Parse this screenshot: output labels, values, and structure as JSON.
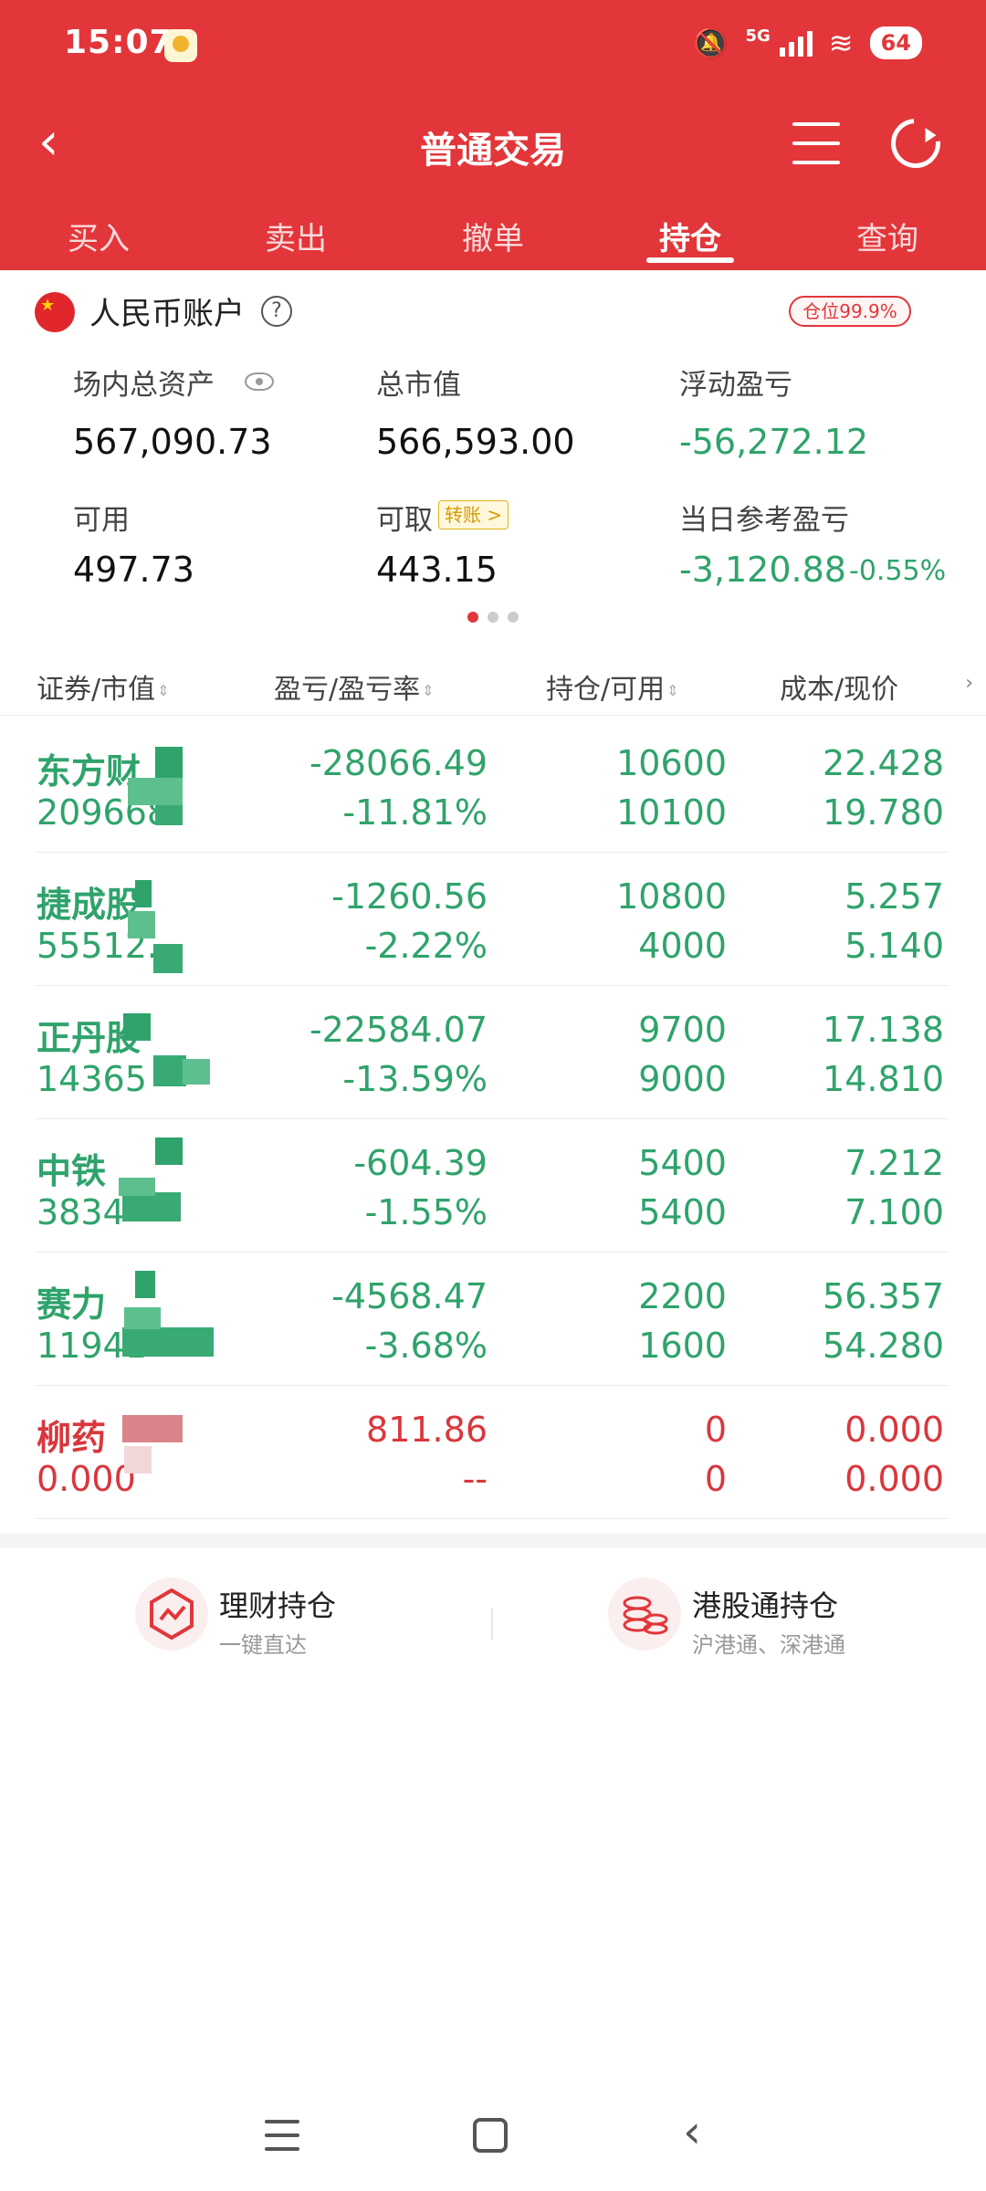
{
  "status_bar": {
    "time": "15:07",
    "network": "5G",
    "battery": "64"
  },
  "nav": {
    "title": "普通交易",
    "back_icon": "chevron-left-icon",
    "menu_icon": "menu-icon",
    "refresh_icon": "refresh-icon"
  },
  "tabs": [
    "买入",
    "卖出",
    "撤单",
    "持仓",
    "查询"
  ],
  "active_tab": "持仓",
  "account": {
    "title": "人民币账户",
    "position_ratio": "仓位99.9%",
    "total_assets_label": "场内总资产",
    "total_assets": "567,090.73",
    "market_value_label": "总市值",
    "market_value": "566,593.00",
    "floating_pl_label": "浮动盈亏",
    "floating_pl": "-56,272.12",
    "available_label": "可用",
    "available": "497.73",
    "withdrawable_label": "可取",
    "transfer_label": "转账 >",
    "withdrawable": "443.15",
    "daily_pl_label": "当日参考盈亏",
    "daily_pl": "-3,120.88",
    "daily_pl_pct": "-0.55%"
  },
  "table": {
    "headers": [
      "证券/市值",
      "盈亏/盈亏率",
      "持仓/可用",
      "成本/现价"
    ],
    "rows": [
      {
        "name": "东方财",
        "market_value": "209668",
        "pl": "-28066.49",
        "pl_rate": "-11.81%",
        "holding": "10600",
        "available": "10100",
        "cost": "22.428",
        "price": "19.780",
        "color": "#2fa36b"
      },
      {
        "name": "捷成股",
        "market_value": "55512.",
        "pl": "-1260.56",
        "pl_rate": "-2.22%",
        "holding": "10800",
        "available": "4000",
        "cost": "5.257",
        "price": "5.140",
        "color": "#2fa36b"
      },
      {
        "name": "正丹股",
        "market_value": "14365",
        "pl": "-22584.07",
        "pl_rate": "-13.59%",
        "holding": "9700",
        "available": "9000",
        "cost": "17.138",
        "price": "14.810",
        "color": "#2fa36b"
      },
      {
        "name": "中铁",
        "market_value": "3834",
        "pl": "-604.39",
        "pl_rate": "-1.55%",
        "holding": "5400",
        "available": "5400",
        "cost": "7.212",
        "price": "7.100",
        "color": "#2fa36b"
      },
      {
        "name": "赛力",
        "market_value": "11941",
        "pl": "-4568.47",
        "pl_rate": "-3.68%",
        "holding": "2200",
        "available": "1600",
        "cost": "56.357",
        "price": "54.280",
        "color": "#2fa36b"
      },
      {
        "name": "柳药",
        "market_value": "0.000",
        "pl": "811.86",
        "pl_rate": "--",
        "holding": "0",
        "available": "0",
        "cost": "0.000",
        "price": "0.000",
        "color": "#d9373d"
      }
    ]
  },
  "shortcuts": [
    {
      "title": "理财持仓",
      "subtitle": "一键直达",
      "icon": "chart-trend-icon"
    },
    {
      "title": "港股通持仓",
      "subtitle": "沪港通、深港通",
      "icon": "coins-icon"
    }
  ]
}
